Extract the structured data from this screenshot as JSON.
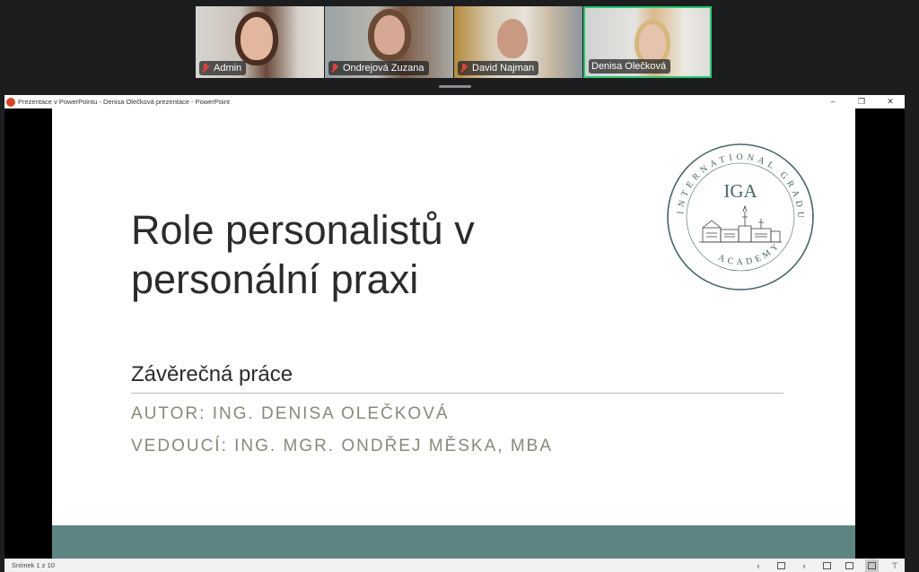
{
  "participants": [
    {
      "name": "Admin",
      "muted": true
    },
    {
      "name": "Ondrejová Zuzana",
      "muted": true
    },
    {
      "name": "David Najman",
      "muted": true
    },
    {
      "name": "Denisa Olečková",
      "muted": false,
      "active_speaker": true
    }
  ],
  "window": {
    "title": "Prezentace v PowerPointu  -  Denisa Olečková prezentace - PowerPoint",
    "minimize": "–",
    "restore": "❐",
    "close": "✕"
  },
  "slide": {
    "title_line1": "Role personalistů v",
    "title_line2": "personální praxi",
    "subtitle": "Závěrečná práce",
    "author": "AUTOR: ING. DENISA OLEČKOVÁ",
    "supervisor": "VEDOUCÍ: ING. MGR. ONDŘEJ MĚSKA, MBA",
    "logo": {
      "abbr": "IGA",
      "ring_text_top": "INTERNATIONAL GRADUATE",
      "ring_text_bottom": "ACADEMY",
      "color": "#47666a"
    },
    "accent_color": "#5e8584"
  },
  "statusbar": {
    "slide_counter": "Snímek 1 z 10",
    "prev": "‹",
    "next": "›"
  }
}
